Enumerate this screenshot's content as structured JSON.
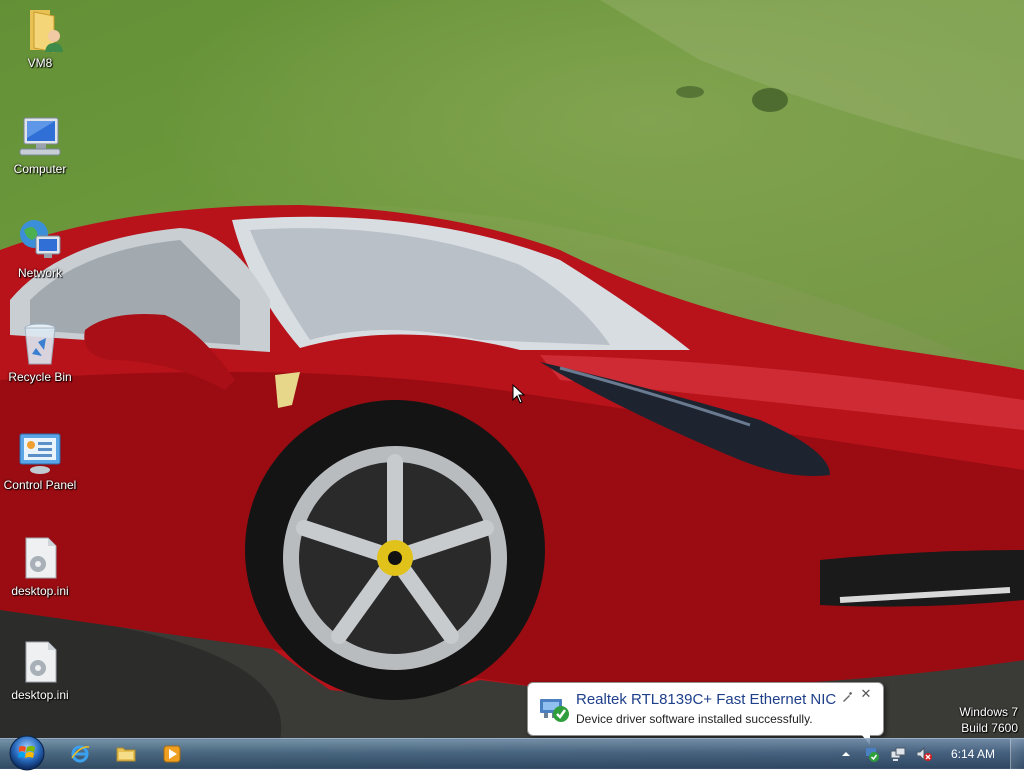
{
  "desktop": {
    "wallpaper_subject": "red sports car on green hillside",
    "icons": [
      {
        "label": "VM8",
        "icon": "user-folder-icon"
      },
      {
        "label": "Computer",
        "icon": "computer-icon"
      },
      {
        "label": "Network",
        "icon": "network-icon"
      },
      {
        "label": "Recycle Bin",
        "icon": "recycle-bin-icon"
      },
      {
        "label": "Control Panel",
        "icon": "control-panel-icon"
      },
      {
        "label": "desktop.ini",
        "icon": "settings-file-icon"
      },
      {
        "label": "desktop.ini",
        "icon": "settings-file-icon"
      }
    ]
  },
  "watermark": {
    "line1": "Windows 7",
    "line2": "Build 7600"
  },
  "notification": {
    "title": "Realtek RTL8139C+ Fast Ethernet NIC",
    "message": "Device driver software installed successfully.",
    "icon": "device-installed-icon"
  },
  "taskbar": {
    "start": "start-orb-icon",
    "pinned": [
      {
        "name": "Internet Explorer",
        "icon": "internet-explorer-icon"
      },
      {
        "name": "Windows Explorer",
        "icon": "folder-icon"
      },
      {
        "name": "Windows Media Player",
        "icon": "media-player-icon"
      }
    ],
    "tray": [
      "show-hidden-icons",
      "device-install-icon",
      "network-icon",
      "volume-muted-icon"
    ],
    "clock": "6:14 AM"
  },
  "colors": {
    "taskbar": "#4a6a8f",
    "balloon_title": "#1e3f8a",
    "car_red": "#c0121a"
  }
}
